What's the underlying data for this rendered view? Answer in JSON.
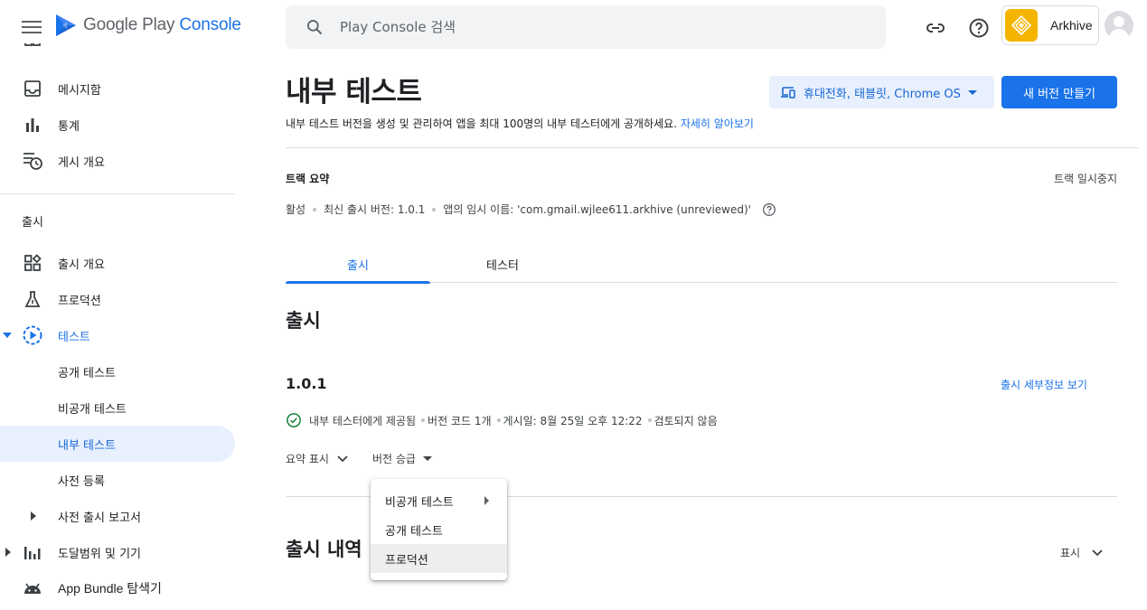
{
  "header": {
    "logo_text_1": "Google Play ",
    "logo_text_2": "Console",
    "search_placeholder": "Play Console 검색",
    "account_name": "Arkhive"
  },
  "sidebar": {
    "top_items": [
      {
        "label": "메시지함",
        "icon": "inbox-icon"
      },
      {
        "label": "통계",
        "icon": "bar-chart-icon"
      },
      {
        "label": "게시 개요",
        "icon": "schedule-list-icon"
      }
    ],
    "section_label": "출시",
    "items": [
      {
        "label": "출시 개요",
        "icon": "dashboard-icon"
      },
      {
        "label": "프로덕션",
        "icon": "flask-icon"
      },
      {
        "label": "테스트",
        "icon": "play-circle-icon"
      },
      {
        "label": "공개 테스트"
      },
      {
        "label": "비공개 테스트"
      },
      {
        "label": "내부 테스트"
      },
      {
        "label": "사전 등록"
      },
      {
        "label": "사전 출시 보고서"
      },
      {
        "label": "도달범위 및 기기",
        "icon": "reach-chart-icon"
      },
      {
        "label": "App Bundle 탐색기",
        "icon": "android-icon"
      }
    ]
  },
  "page": {
    "title": "내부 테스트",
    "device_button": "휴대전화, 태블릿, Chrome OS",
    "new_release_button": "새 버전 만들기",
    "description": "내부 테스트 버전을 생성 및 관리하여 앱을 최대 100명의 내부 테스터에게 공개하세요.",
    "learn_more": "자세히 알아보기",
    "track_summary_title": "트랙 요약",
    "pause_track": "트랙 일시중지",
    "track_status": "활성",
    "latest_version": "최신 출시 버전: 1.0.1",
    "temp_name": "앱의 임시 이름: 'com.gmail.wjlee611.arkhive (unreviewed)'",
    "tabs": [
      "출시",
      "테스터"
    ],
    "release_heading": "출시",
    "version": "1.0.1",
    "release_details_link": "출시 세부정보 보기",
    "status": {
      "availability": "내부 테스터에게 제공됨",
      "version_codes": "버전 코드 1개",
      "published": "게시일: 8월 25일 오후 12:22",
      "review": "검토되지 않음"
    },
    "show_summary": "요약 표시",
    "promote_release": "버전 승급",
    "history_heading": "출시 내역",
    "show_label": "표시"
  },
  "menu": {
    "items": [
      "비공개 테스트",
      "공개 테스트",
      "프로덕션"
    ]
  },
  "colors": {
    "accent": "#1a73e8",
    "selected_bg": "#e8f0fe",
    "status_ok": "#188038",
    "app_icon": "#f4b400"
  }
}
